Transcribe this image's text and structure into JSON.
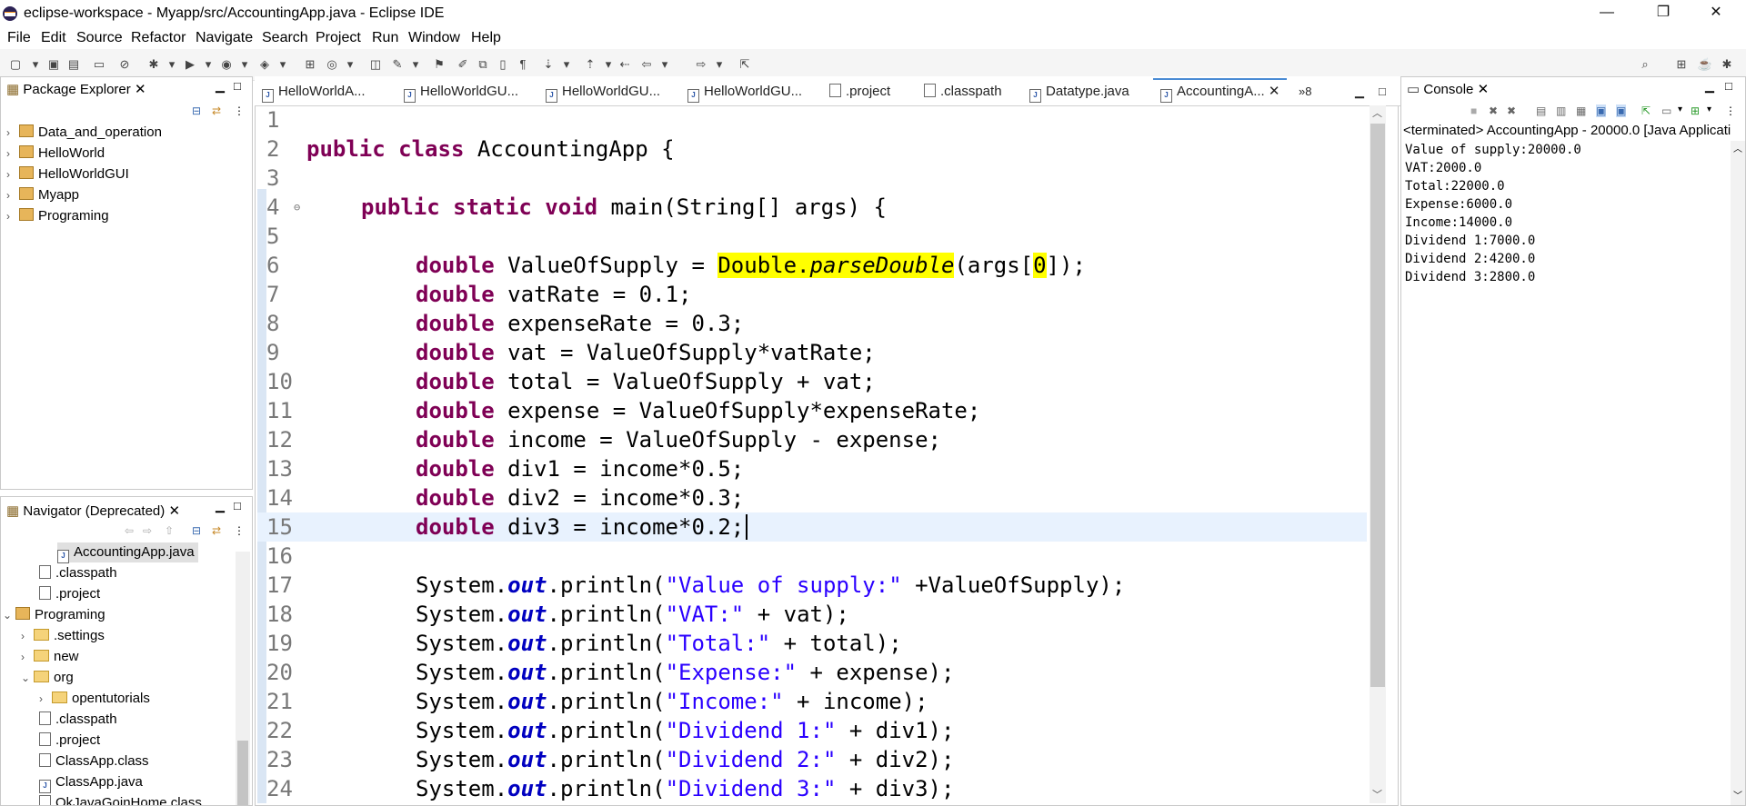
{
  "window": {
    "title": "eclipse-workspace - Myapp/src/AccountingApp.java - Eclipse IDE",
    "controls": [
      "—",
      "❐",
      "✕"
    ]
  },
  "menu": [
    "File",
    "Edit",
    "Source",
    "Refactor",
    "Navigate",
    "Search",
    "Project",
    "Run",
    "Window",
    "Help"
  ],
  "package_explorer": {
    "title": "Package Explorer",
    "items": [
      "Data_and_operation",
      "HelloWorld",
      "HelloWorldGUI",
      "Myapp",
      "Programing"
    ]
  },
  "navigator": {
    "title": "Navigator (Deprecated)",
    "items": [
      {
        "label": "AccountingApp.java",
        "type": "java"
      },
      {
        "label": ".classpath",
        "type": "file"
      },
      {
        "label": ".project",
        "type": "file"
      },
      {
        "label": "Programing",
        "type": "project"
      },
      {
        "label": ".settings",
        "type": "folder"
      },
      {
        "label": "new",
        "type": "folder"
      },
      {
        "label": "org",
        "type": "folder"
      },
      {
        "label": "opentutorials",
        "type": "folder"
      },
      {
        "label": ".classpath",
        "type": "file"
      },
      {
        "label": ".project",
        "type": "file"
      },
      {
        "label": "ClassApp.class",
        "type": "file"
      },
      {
        "label": "ClassApp.java",
        "type": "java"
      },
      {
        "label": "OkJavaGoinHome.class",
        "type": "file"
      }
    ]
  },
  "editor": {
    "tabs": [
      "HelloWorldA...",
      "HelloWorldGU...",
      "HelloWorldGU...",
      "HelloWorldGU...",
      ".project",
      ".classpath",
      "Datatype.java",
      "AccountingA..."
    ],
    "overflow": "»8",
    "line_numbers": [
      "1",
      "2",
      "3",
      "4",
      "5",
      "6",
      "7",
      "8",
      "9",
      "10",
      "11",
      "12",
      "13",
      "14",
      "15",
      "16",
      "17",
      "18",
      "19",
      "20",
      "21",
      "22",
      "23",
      "24"
    ],
    "code": {
      "l2_kw": "public class",
      "l2_rest": " AccountingApp {",
      "l4_kw": "public static void",
      "l4_rest": " main(String[] args) {",
      "double_kw": "double",
      "l6_a": " ValueOfSupply = ",
      "l6_hl": "Double.",
      "l6_hl_it": "parseDouble",
      "l6_b": "(args[",
      "l6_idx": "0",
      "l6_c": "]);",
      "l7": " vatRate = 0.1;",
      "l8": " expenseRate = 0.3;",
      "l9": " vat = ValueOfSupply*vatRate;",
      "l10": " total = ValueOfSupply + vat;",
      "l11": " expense = ValueOfSupply*expenseRate;",
      "l12": " income = ValueOfSupply - expense;",
      "l13": " div1 = income*0.5;",
      "l14": " div2 = income*0.3;",
      "l15": " div3 = income*0.2;",
      "sys": "System.",
      "out": "out",
      "println": ".println(",
      "p17_s": "\"Value of supply:\"",
      "p17_r": " +ValueOfSupply);",
      "p18_s": "\"VAT:\"",
      "p18_r": " + vat);",
      "p19_s": "\"Total:\"",
      "p19_r": " + total);",
      "p20_s": "\"Expense:\"",
      "p20_r": " + expense);",
      "p21_s": "\"Income:\"",
      "p21_r": " + income);",
      "p22_s": "\"Dividend 1:\"",
      "p22_r": " + div1);",
      "p23_s": "\"Dividend 2:\"",
      "p23_r": " + div2);",
      "p24_s": "\"Dividend 3:\"",
      "p24_r": " + div3);"
    }
  },
  "console": {
    "title": "Console",
    "status": "<terminated> AccountingApp - 20000.0 [Java Applicati",
    "output": [
      "Value of supply:20000.0",
      "VAT:2000.0",
      "Total:22000.0",
      "Expense:6000.0",
      "Income:14000.0",
      "Dividend 1:7000.0",
      "Dividend 2:4200.0",
      "Dividend 3:2800.0"
    ]
  }
}
